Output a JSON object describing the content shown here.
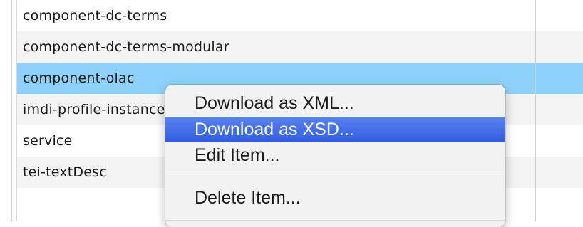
{
  "table": {
    "rows": [
      {
        "label": "component-dc-terms"
      },
      {
        "label": "component-dc-terms-modular"
      },
      {
        "label": "component-olac"
      },
      {
        "label": "imdi-profile-instance"
      },
      {
        "label": "service"
      },
      {
        "label": "tei-textDesc"
      },
      {
        "label": ""
      }
    ],
    "selected_index": 2
  },
  "context_menu": {
    "items": [
      {
        "label": "Download as XML..."
      },
      {
        "label": "Download as XSD..."
      },
      {
        "label": "Edit Item..."
      },
      {
        "label": "Delete Item..."
      }
    ],
    "highlighted_index": 1
  },
  "colors": {
    "selection": "#8ed2fb",
    "menu_highlight": "#2f5de0",
    "row_alt": "#f3f3f3"
  }
}
